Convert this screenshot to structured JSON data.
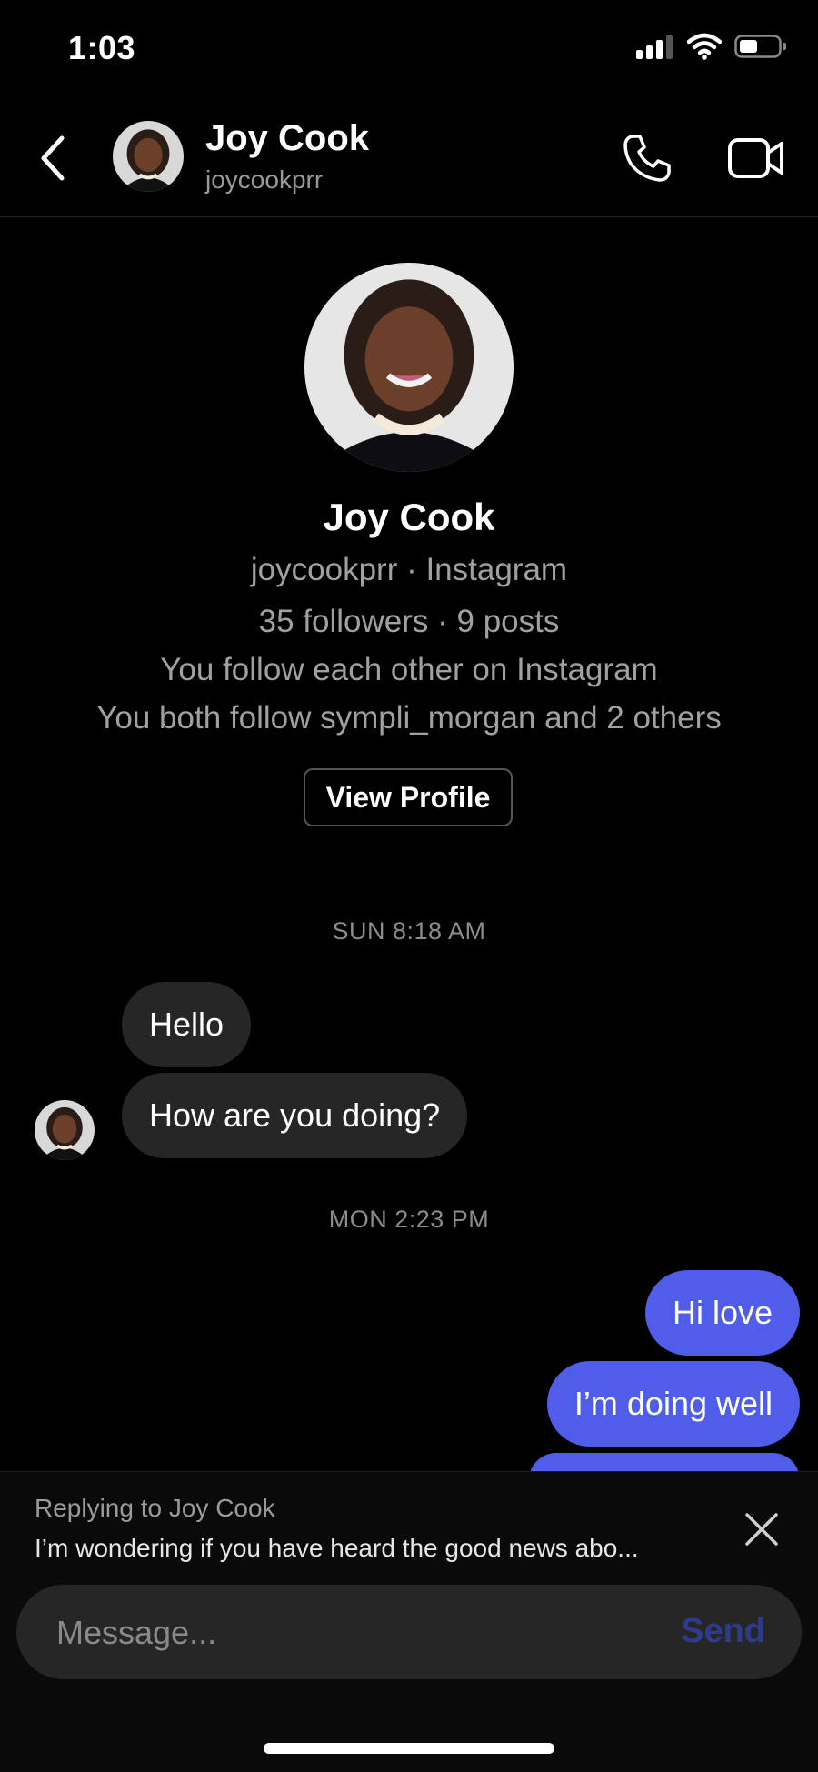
{
  "status_bar": {
    "time": "1:03"
  },
  "header": {
    "name": "Joy Cook",
    "username": "joycookprr"
  },
  "profile": {
    "name": "Joy Cook",
    "handle_line": "joycookprr · Instagram",
    "stats_line": "35 followers · 9 posts",
    "mutual_line": "You follow each other on Instagram",
    "common_line": "You both follow sympli_morgan and 2 others",
    "view_profile_label": "View Profile"
  },
  "conversation": {
    "stamp1": "SUN 8:18 AM",
    "incoming": [
      "Hello",
      "How are you doing?"
    ],
    "stamp2": "MON 2:23 PM",
    "outgoing": [
      "Hi love",
      "I’m doing well"
    ]
  },
  "reply": {
    "label": "Replying to Joy Cook",
    "preview": "I’m wondering if you have heard the good news abo..."
  },
  "composer": {
    "placeholder": "Message...",
    "send_label": "Send"
  },
  "colors": {
    "outgoing_bubble": "#4f5de8",
    "incoming_bubble": "#262626",
    "send_disabled": "#2e3a8a"
  },
  "icons": [
    "back-arrow-icon",
    "phone-icon",
    "video-camera-icon",
    "close-icon",
    "signal-icon",
    "wifi-icon",
    "battery-icon"
  ]
}
